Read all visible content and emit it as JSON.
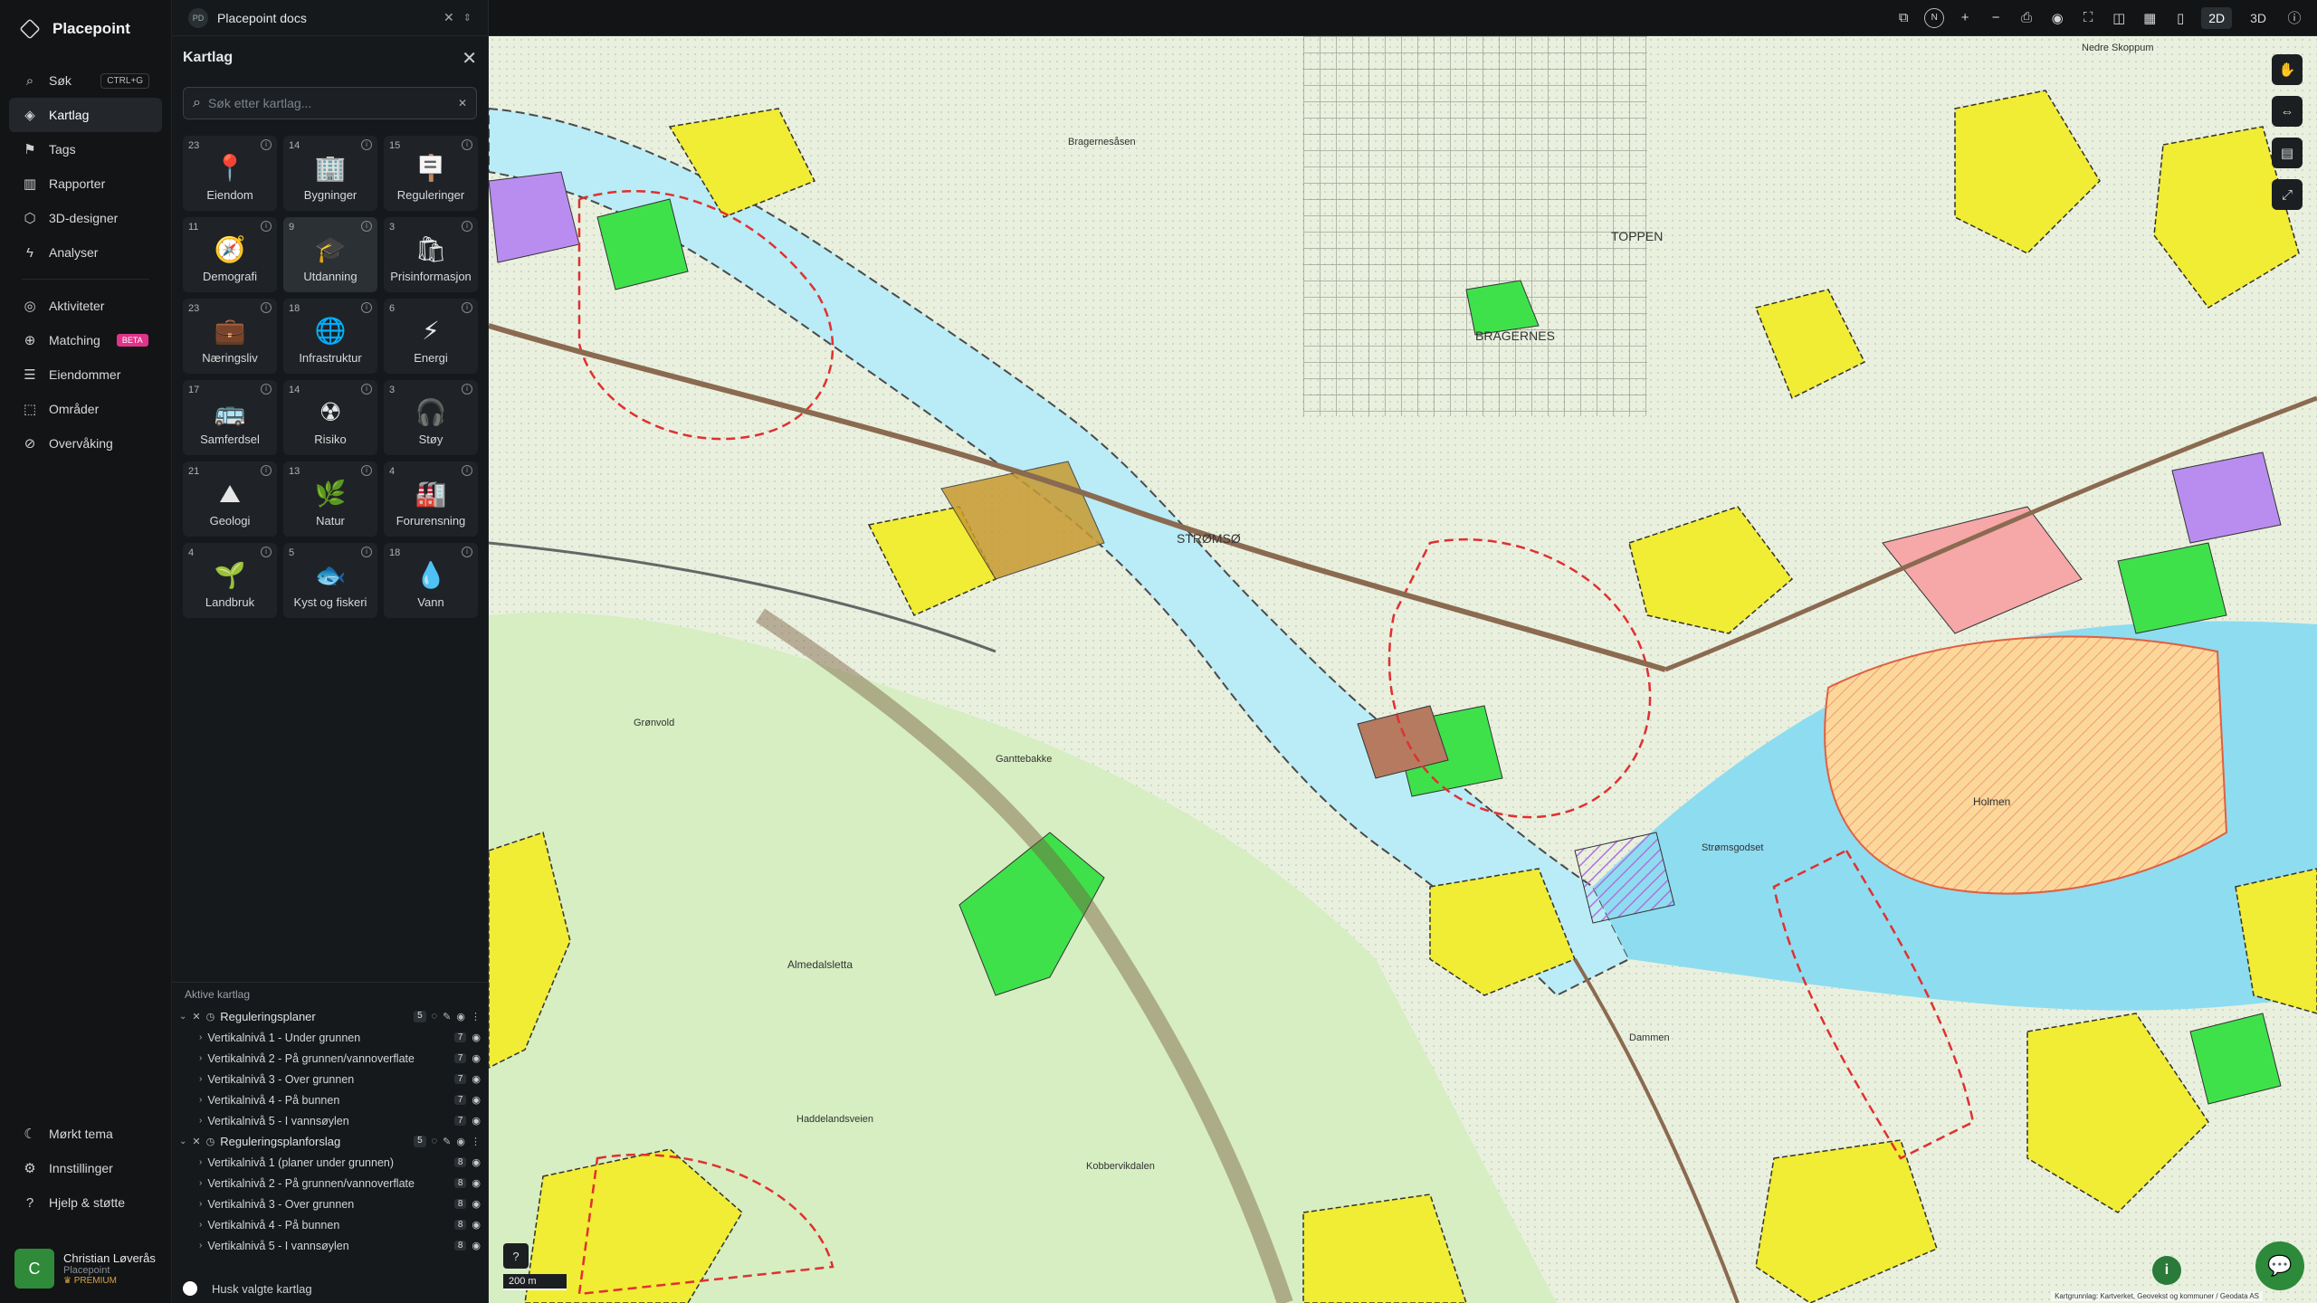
{
  "app": {
    "name": "Placepoint"
  },
  "nav": {
    "items": [
      {
        "label": "Søk",
        "shortcut": "CTRL+G",
        "icon": "search-icon"
      },
      {
        "label": "Kartlag",
        "icon": "layers-icon"
      },
      {
        "label": "Tags",
        "icon": "bookmark-icon"
      },
      {
        "label": "Rapporter",
        "icon": "bar-chart-icon"
      },
      {
        "label": "3D-designer",
        "icon": "cube-icon"
      },
      {
        "label": "Analyser",
        "icon": "bolt-icon"
      }
    ],
    "items2": [
      {
        "label": "Aktiviteter",
        "icon": "activity-icon"
      },
      {
        "label": "Matching",
        "badge": "BETA",
        "icon": "match-icon"
      },
      {
        "label": "Eiendommer",
        "icon": "list-icon"
      },
      {
        "label": "Områder",
        "icon": "area-icon"
      },
      {
        "label": "Overvåking",
        "icon": "watch-icon"
      }
    ],
    "bottom": [
      {
        "label": "Mørkt tema",
        "icon": "moon-icon"
      },
      {
        "label": "Innstillinger",
        "icon": "gear-icon"
      },
      {
        "label": "Hjelp & støtte",
        "icon": "help-icon"
      }
    ],
    "user": {
      "initial": "C",
      "name": "Christian Løverås",
      "org": "Placepoint",
      "plan": "PREMIUM"
    }
  },
  "workspace": {
    "badge": "PD",
    "name": "Placepoint docs"
  },
  "panel": {
    "title": "Kartlag",
    "search_placeholder": "Søk etter kartlag...",
    "categories": [
      {
        "count": "23",
        "label": "Eiendom",
        "glyph": "📍"
      },
      {
        "count": "14",
        "label": "Bygninger",
        "glyph": "🏢"
      },
      {
        "count": "15",
        "label": "Reguleringer",
        "glyph": "🪧"
      },
      {
        "count": "11",
        "label": "Demografi",
        "glyph": "🧭"
      },
      {
        "count": "9",
        "label": "Utdanning",
        "glyph": "🎓"
      },
      {
        "count": "3",
        "label": "Prisinformasjon",
        "glyph": "🛍"
      },
      {
        "count": "23",
        "label": "Næringsliv",
        "glyph": "💼"
      },
      {
        "count": "18",
        "label": "Infrastruktur",
        "glyph": "🌐"
      },
      {
        "count": "6",
        "label": "Energi",
        "glyph": "⚡"
      },
      {
        "count": "17",
        "label": "Samferdsel",
        "glyph": "🚌"
      },
      {
        "count": "14",
        "label": "Risiko",
        "glyph": "☢"
      },
      {
        "count": "3",
        "label": "Støy",
        "glyph": "🎧"
      },
      {
        "count": "21",
        "label": "Geologi",
        "glyph": "⛰"
      },
      {
        "count": "13",
        "label": "Natur",
        "glyph": "🌿"
      },
      {
        "count": "4",
        "label": "Forurensning",
        "glyph": "🏭"
      },
      {
        "count": "4",
        "label": "Landbruk",
        "glyph": "🌱"
      },
      {
        "count": "5",
        "label": "Kyst og fiskeri",
        "glyph": "🐟"
      },
      {
        "count": "18",
        "label": "Vann",
        "glyph": "💧"
      }
    ],
    "active_title": "Aktive kartlag",
    "groups": [
      {
        "name": "Reguleringsplaner",
        "count": "5",
        "subs": [
          {
            "label": "Vertikalnivå 1 - Under grunnen",
            "n": "7"
          },
          {
            "label": "Vertikalnivå 2 - På grunnen/vannoverflate",
            "n": "7"
          },
          {
            "label": "Vertikalnivå 3 - Over grunnen",
            "n": "7"
          },
          {
            "label": "Vertikalnivå 4 - På bunnen",
            "n": "7"
          },
          {
            "label": "Vertikalnivå 5 - I vannsøylen",
            "n": "7"
          }
        ]
      },
      {
        "name": "Reguleringsplanforslag",
        "count": "5",
        "subs": [
          {
            "label": "Vertikalnivå 1 (planer under grunnen)",
            "n": "8"
          },
          {
            "label": "Vertikalnivå 2 - På grunnen/vannoverflate",
            "n": "8"
          },
          {
            "label": "Vertikalnivå 3 - Over grunnen",
            "n": "8"
          },
          {
            "label": "Vertikalnivå 4 - På bunnen",
            "n": "8"
          },
          {
            "label": "Vertikalnivå 5 - I vannsøylen",
            "n": "8"
          }
        ]
      }
    ],
    "remember": "Husk valgte kartlag"
  },
  "topbar": {
    "compass": "N",
    "mode2d": "2D",
    "mode3d": "3D"
  },
  "map": {
    "scale": "200 m",
    "labels": [
      "BRAGERNES",
      "TOPPEN",
      "STRØMSØ",
      "Nedre Skoppum",
      "Holmen",
      "Strømsgodset",
      "Almedalsletta",
      "Grønvold",
      "Kobbervikdalen",
      "Ganttebakke",
      "Haddelandsveien",
      "Bragernesåsen",
      "Dammen"
    ],
    "attribution": "Kartgrunnlag: Kartverket, Geovekst og kommuner / Geodata AS"
  },
  "colors": {
    "accent": "#2d8a3b",
    "beta": "#e0338a",
    "water": "#b8eaf5",
    "forest": "#d4ecc0",
    "yellow": "#f2ee36",
    "green": "#3ee04a",
    "pink": "#f7a6a6",
    "purple": "#b48cf0"
  }
}
